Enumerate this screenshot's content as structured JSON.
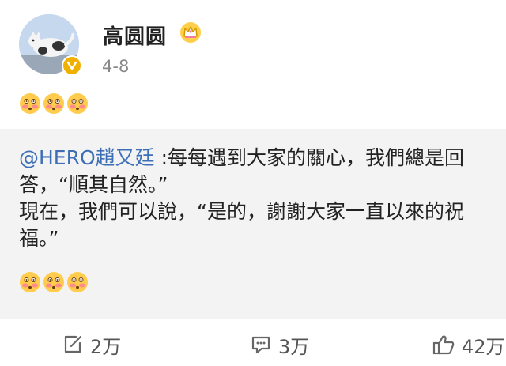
{
  "post": {
    "author": "高圆圆",
    "date": "4-8",
    "emoji": [
      "flushed-face",
      "flushed-face",
      "flushed-face"
    ]
  },
  "quote": {
    "mention": "@HERO趙又廷",
    "line1_rest": " :每每遇到大家的關心，我們總是回",
    "line2": "答，“順其自然。”",
    "line3": "現在，我們可以說，“是的，謝謝大家一直以來的祝",
    "line4": "福。”",
    "emoji": [
      "flushed-face",
      "flushed-face",
      "flushed-face"
    ]
  },
  "actions": {
    "repost_count": "2万",
    "comment_count": "3万",
    "like_count": "42万"
  },
  "colors": {
    "mention": "#3d6fb6",
    "verify_badge": "#f0b000",
    "quote_bg": "#f3f3f3"
  }
}
